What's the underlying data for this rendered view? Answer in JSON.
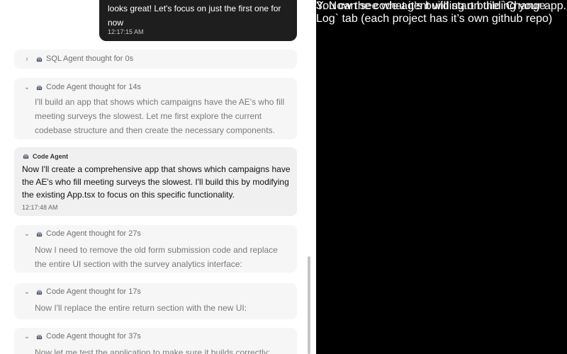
{
  "chat": {
    "user_message": {
      "text": "looks great! Let's focus on just the first one for now",
      "time": "12:17:15 AM"
    },
    "thoughts_top": [
      {
        "label": "SQL Agent thought for 0s",
        "icon": "robot-icon",
        "chevron": "›",
        "expanded": false
      }
    ],
    "thought_1": {
      "label": "Code Agent thought for 14s",
      "icon": "robot-icon",
      "chevron": "⌄",
      "text": "I'll build an app that shows which campaigns have the AE's who fill meeting surveys the slowest. Let me first explore the current codebase structure and then create the necessary components."
    },
    "agent_message": {
      "name": "Code Agent",
      "icon": "robot-icon",
      "text": "Now I'll create a comprehensive app that shows which campaigns have the AE's who fill meeting surveys the slowest. I'll build this by modifying the existing App.tsx to focus on this specific functionality.",
      "time": "12:17:48 AM"
    },
    "thought_2": {
      "label": "Code Agent thought for 27s",
      "icon": "robot-icon",
      "chevron": "⌄",
      "text": "Now I need to remove the old form submission code and replace the entire UI section with the survey analytics interface:"
    },
    "thought_3": {
      "label": "Code Agent thought for 17s",
      "icon": "robot-icon",
      "chevron": "⌄",
      "text": "Now I'll replace the entire return section with the new UI:"
    },
    "thought_4": {
      "label": "Code Agent thought for 37s",
      "icon": "robot-icon",
      "chevron": "⌄",
      "text": "Now let me test the application to make sure it builds correctly:"
    }
  },
  "annotation": {
    "title": "3. Now the code agent will start building your app.",
    "body": "You can see what it’s building on the `Change Log` tab (each project has it’s own github repo)"
  },
  "colors": {
    "panel_bg": "#000000",
    "user_bubble": "#1e1e1e",
    "thought_bg": "#f6f6f7",
    "agent_bg": "#f0f0f1"
  }
}
